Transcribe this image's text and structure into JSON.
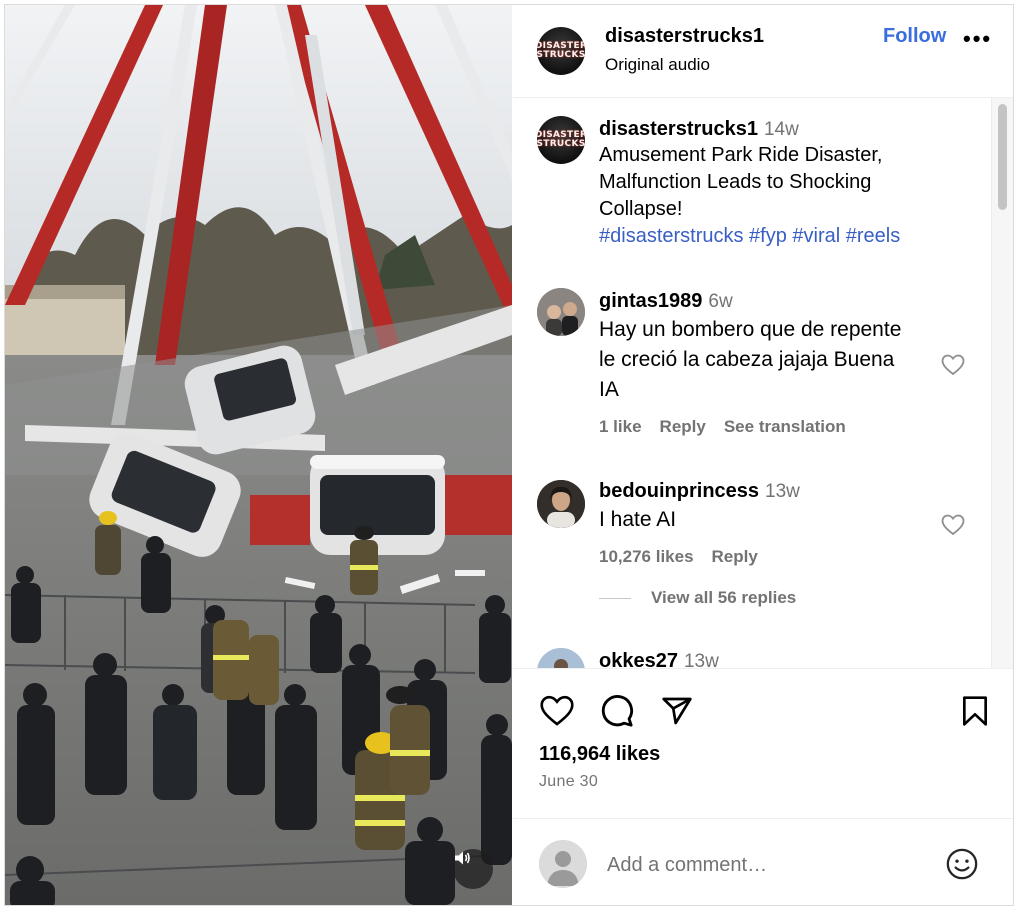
{
  "post": {
    "author": {
      "username": "disasterstrucks1",
      "subtitle": "Original audio",
      "avatar_text": [
        "DISASTER",
        "STRUCKS"
      ]
    },
    "follow_label": "Follow",
    "more_label": "•••",
    "caption": {
      "username": "disasterstrucks1",
      "time": "14w",
      "text": "Amusement Park Ride Disaster, Malfunction Leads to Shocking Collapse!",
      "hashtags": "#disasterstrucks #fyp #viral #reels"
    },
    "likes": "116,964 likes",
    "date": "June 30"
  },
  "comments": [
    {
      "username": "gintas1989",
      "time": "6w",
      "text": "Hay un bombero que de repente le creció la cabeza jajaja Buena IA",
      "likes": "1 like",
      "reply": "Reply",
      "translate": "See translation"
    },
    {
      "username": "bedouinprincess",
      "time": "13w",
      "text": "I hate AI",
      "likes": "10,276 likes",
      "reply": "Reply",
      "view_replies": "View all 56 replies"
    },
    {
      "username": "okkes27",
      "time": "13w"
    }
  ],
  "comment_box": {
    "placeholder": "Add a comment…"
  },
  "icons": [
    "heart-icon",
    "comment-icon",
    "share-icon",
    "bookmark-icon",
    "smile-icon",
    "mute-icon",
    "more-icon"
  ]
}
